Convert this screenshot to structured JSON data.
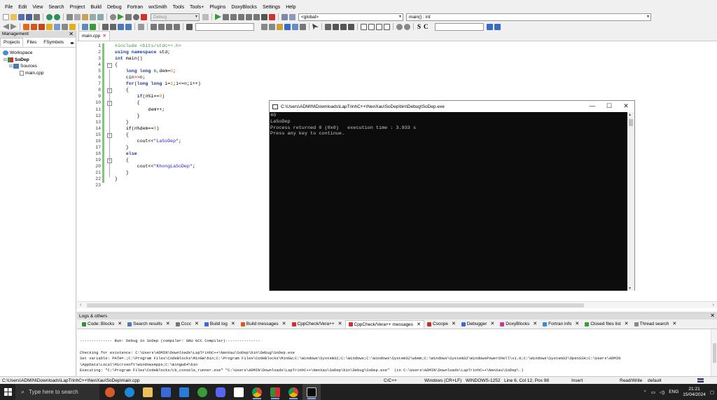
{
  "menubar": [
    "File",
    "Edit",
    "View",
    "Search",
    "Project",
    "Build",
    "Debug",
    "Fortran",
    "wxSmith",
    "Tools",
    "Tools+",
    "Plugins",
    "DoxyBlocks",
    "Settings",
    "Help"
  ],
  "toolbar": {
    "build_target": "Debug",
    "scope": "<global>",
    "symbol": "main() : int",
    "search_text": "",
    "find_text": "",
    "c_buttons": [
      "S",
      "C"
    ]
  },
  "management": {
    "title": "Management",
    "tabs": [
      "Projects",
      "Files",
      "FSymbols"
    ],
    "tree": [
      {
        "label": "Workspace",
        "level": 0
      },
      {
        "label": "SoDep",
        "level": 1
      },
      {
        "label": "Sources",
        "level": 2
      },
      {
        "label": "main.cpp",
        "level": 3
      }
    ]
  },
  "editor": {
    "tab": "main.cpp",
    "line_numbers": [
      "1",
      "2",
      "3",
      "4",
      "5",
      "6",
      "7",
      "8",
      "9",
      "10",
      "11",
      "12",
      "13",
      "14",
      "15",
      "16",
      "17",
      "18",
      "19",
      "20",
      "21",
      "22",
      "23"
    ],
    "lines": [
      {
        "t": "pre",
        "a": "#include <bits/stdc++.h>"
      },
      {
        "t": "kw2",
        "a": "using namespace",
        "b": " std;"
      },
      {
        "t": "kw2",
        "a": "int",
        "b": " main()"
      },
      {
        "t": "plain",
        "a": "{"
      },
      {
        "t": "decl",
        "a": "    long long",
        "b": " n,dem=",
        "c": "0",
        "d": ";"
      },
      {
        "t": "op",
        "a": "    cin",
        "b": ">>",
        "c": "n;"
      },
      {
        "t": "for",
        "a": "    for",
        "b": "(",
        "c": "long long",
        "d": " i=",
        "e": "1",
        "f": ";i<=n;i++)"
      },
      {
        "t": "plain",
        "a": "    {"
      },
      {
        "t": "if",
        "a": "        if",
        "b": "(n%i==",
        "c": "0",
        "d": ")"
      },
      {
        "t": "plain",
        "a": "        {"
      },
      {
        "t": "plain",
        "a": "            dem++;"
      },
      {
        "t": "plain",
        "a": "        }"
      },
      {
        "t": "plain",
        "a": "    }"
      },
      {
        "t": "if",
        "a": "    if",
        "b": "(n%dem==",
        "c": "0",
        "d": ")"
      },
      {
        "t": "plain",
        "a": "    {"
      },
      {
        "t": "cout",
        "a": "        cout<<",
        "b": "\"LaSoDep\"",
        "c": ";"
      },
      {
        "t": "plain",
        "a": "    }"
      },
      {
        "t": "kwonly",
        "a": "    else"
      },
      {
        "t": "plain",
        "a": "    {"
      },
      {
        "t": "cout",
        "a": "        cout<<",
        "b": "\"KhongLaSoDep\"",
        "c": ";"
      },
      {
        "t": "plain",
        "a": "    }"
      },
      {
        "t": "plain",
        "a": "}"
      },
      {
        "t": "plain",
        "a": ""
      }
    ]
  },
  "console": {
    "title": "C:\\Users\\ADMIN\\Downloads\\LapTrinhC++\\NenXau\\SoDep\\bin\\Debug\\SoDep.exe",
    "output": "40\nLaSoDep\nProcess returned 0 (0x0)   execution time : 3.933 s\nPress any key to continue.",
    "buttons": [
      "—",
      "☐",
      "✕"
    ]
  },
  "logs": {
    "title": "Logs & others",
    "tabs": [
      "Code::Blocks",
      "Search results",
      "Cccc",
      "Build log",
      "Build messages",
      "CppCheck/Vera++",
      "CppCheck/Vera++ messages",
      "Cscope",
      "Debugger",
      "DoxyBlocks",
      "Fortran info",
      "Closed files list",
      "Thread search"
    ],
    "active_tab": "CppCheck/Vera++ messages",
    "text": "\n-------------- Run: Debug in SoDep (compiler: GNU GCC Compiler)---------------\n\nChecking for existence: C:\\Users\\ADMIN\\Downloads\\LapTrinhC++\\NenXau\\SoDep\\bin\\Debug\\SoDep.exe\nSet variable: PATH=.;C:\\Program Files\\CodeBlocks\\MinGW\\bin;C:\\Program Files\\CodeBlocks\\MinGW;C:\\Windows\\System32;C:\\Windows;C:\\Windows\\System32\\wbem;C:\\Windows\\System32\\WindowsPowerShell\\v1.0;C:\\Windows\\System32\\OpenSSH;C:\\Users\\ADMIN\n\\AppData\\Local\\Microsoft\\WindowsApps;C:\\mingw64\\bin\nExecuting: \"C:\\Program Files\\CodeBlocks/cb_console_runner.exe\" \"C:\\Users\\ADMIN\\Downloads\\LapTrinhC++\\NenXau\\SoDep\\bin\\Debug\\SoDep.exe\"  (in C:\\Users\\ADMIN\\Downloads\\LapTrinhC++\\NenXau\\SoDep\\.)"
  },
  "status": {
    "path": "C:\\Users\\ADMIN\\Downloads\\LapTrinhC++\\NenXau\\SoDep\\main.cpp",
    "language": "C/C++",
    "eol": "Windows (CR+LF)",
    "encoding": "WINDOWS-1252",
    "position": "Line 6, Col 12, Pos 98",
    "mode": "Insert",
    "access": "Read/Write",
    "profile": "default"
  },
  "taskbar": {
    "search_placeholder": "Type here to search",
    "lang": "ENG",
    "time": "21:21",
    "date": "15/04/2024"
  },
  "colors": {
    "accent": "#3d8f3d",
    "keyword": "#1c3c9e",
    "number": "#e37300",
    "string": "#1a1ad6",
    "console_bg": "#0c0c0c",
    "taskbar_bg": "#202020"
  }
}
